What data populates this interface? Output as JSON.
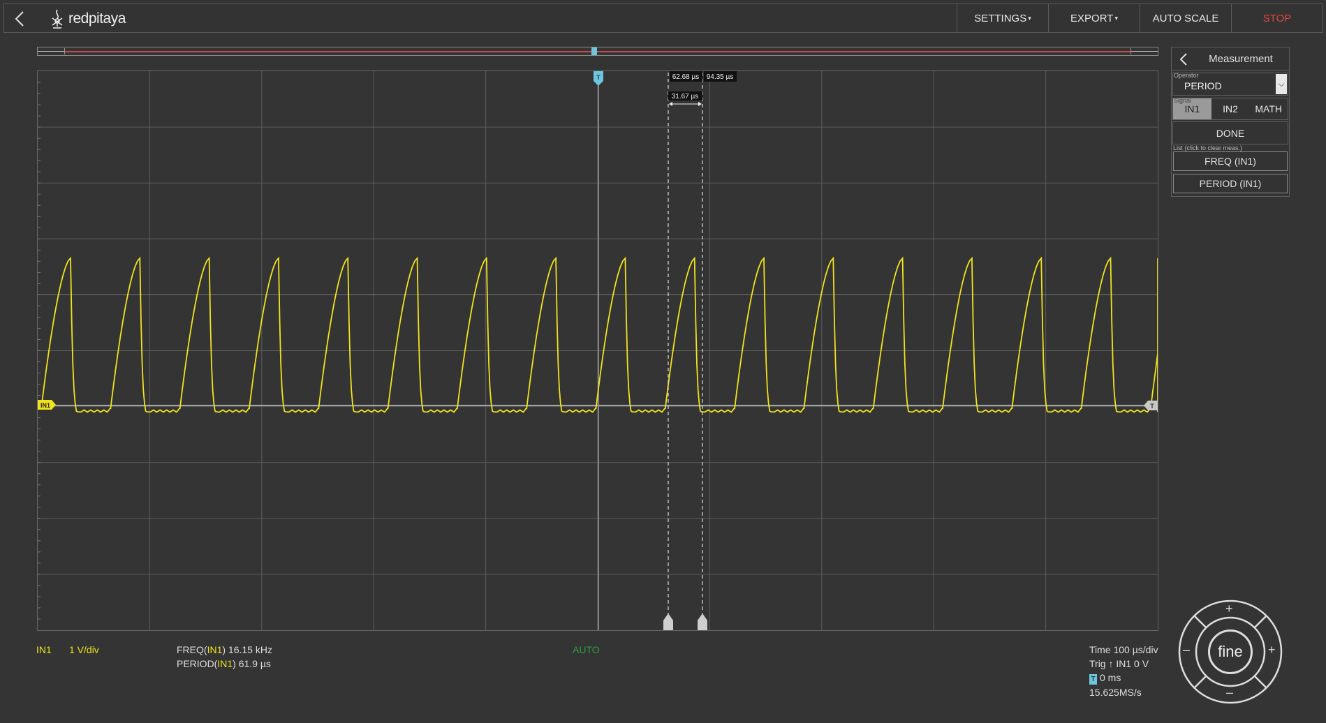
{
  "topbar": {
    "logo_text": "redpitaya",
    "menu": [
      {
        "label": "SETTINGS",
        "caret": "▾"
      },
      {
        "label": "EXPORT",
        "caret": "▾"
      },
      {
        "label": "AUTO SCALE",
        "caret": ""
      },
      {
        "label": "STOP",
        "caret": ""
      }
    ]
  },
  "plot": {
    "trigger_marker": "T",
    "channel_marker": "IN1",
    "level_marker": "T",
    "cursor_x1_label": "62.68 µs",
    "cursor_x2_label": "94.35 µs",
    "cursor_delta_label": "31.67 µs"
  },
  "measurement_panel": {
    "title": "Measurement",
    "operator_label": "Operator",
    "operator_value": "PERIOD",
    "signal_label": "Signal",
    "signals": [
      "IN1",
      "IN2",
      "MATH"
    ],
    "active_signal": "IN1",
    "done_label": "DONE",
    "list_label": "List (click to clear meas.)",
    "list": [
      "FREQ (IN1)",
      "PERIOD (IN1)"
    ]
  },
  "status": {
    "channel": "IN1",
    "scale": "1 V/div",
    "meas1_name": "FREQ(",
    "meas1_ch": "IN1",
    "meas1_value": ") 16.15 kHz",
    "meas2_name": "PERIOD(",
    "meas2_ch": "IN1",
    "meas2_value": ") 61.9 µs",
    "mode": "AUTO",
    "time": "Time 100 µs/div",
    "trig": "Trig ↑ IN1 0 V",
    "t_badge": "T",
    "offset": "0 ms",
    "sample_rate": "15.625MS/s"
  },
  "dial": {
    "center_label": "fine",
    "up": "+",
    "down": "–",
    "left": "–",
    "right": "+"
  },
  "colors": {
    "signal": "#f0e31e",
    "trigger": "#6ec6de",
    "stop": "#e2483f",
    "auto": "#2ea043"
  }
}
